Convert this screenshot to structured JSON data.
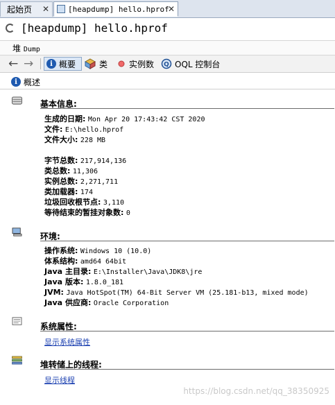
{
  "tabs": [
    {
      "label": "起始页",
      "close": "✕"
    },
    {
      "label": "[heapdump] hello.hprof",
      "close": "✕"
    }
  ],
  "window_title": "[heapdump] hello.hprof",
  "path": {
    "prefix": "堆",
    "value": "Dump"
  },
  "toolbar": {
    "summary_label": "概要",
    "classes_label": "类",
    "instances_label": "实例数",
    "oql_label": "OQL 控制台"
  },
  "subbar_label": "概述",
  "sections": {
    "basic": {
      "title": "基本信息:",
      "rows": [
        {
          "k": "生成的日期:",
          "v": "Mon Apr 20 17:43:42 CST 2020"
        },
        {
          "k": "文件:",
          "v": "E:\\hello.hprof"
        },
        {
          "k": "文件大小:",
          "v": "228 MB"
        },
        {
          "k": "字节总数:",
          "v": "217,914,136"
        },
        {
          "k": "类总数:",
          "v": "11,306"
        },
        {
          "k": "实例总数:",
          "v": "2,271,711"
        },
        {
          "k": "类加载器:",
          "v": "174"
        },
        {
          "k": "垃圾回收根节点:",
          "v": "3,110"
        },
        {
          "k": "等待结束的暂挂对象数:",
          "v": "0"
        }
      ]
    },
    "env": {
      "title": "环境:",
      "rows": [
        {
          "k": "操作系统:",
          "v": "Windows 10 (10.0)"
        },
        {
          "k": "体系结构:",
          "v": "amd64 64bit"
        },
        {
          "k": "Java 主目录:",
          "v": "E:\\Installer\\Java\\JDK8\\jre"
        },
        {
          "k": "Java 版本:",
          "v": "1.8.0_181"
        },
        {
          "k": "JVM:",
          "v": "Java HotSpot(TM) 64-Bit Server VM (25.181-b13, mixed mode)"
        },
        {
          "k": "Java 供应商:",
          "v": "Oracle Corporation"
        }
      ]
    },
    "sysprops": {
      "title": "系统属性:",
      "link": "显示系统属性"
    },
    "threads": {
      "title": "堆转储上的线程:",
      "link": "显示线程"
    }
  },
  "watermark": "https://blog.csdn.net/qq_38350925",
  "icons": {
    "back": "arrow-left-icon",
    "forward": "arrow-right-icon",
    "info": "info-icon",
    "classes": "classes-icon",
    "instances": "instances-icon",
    "oql": "oql-icon"
  }
}
